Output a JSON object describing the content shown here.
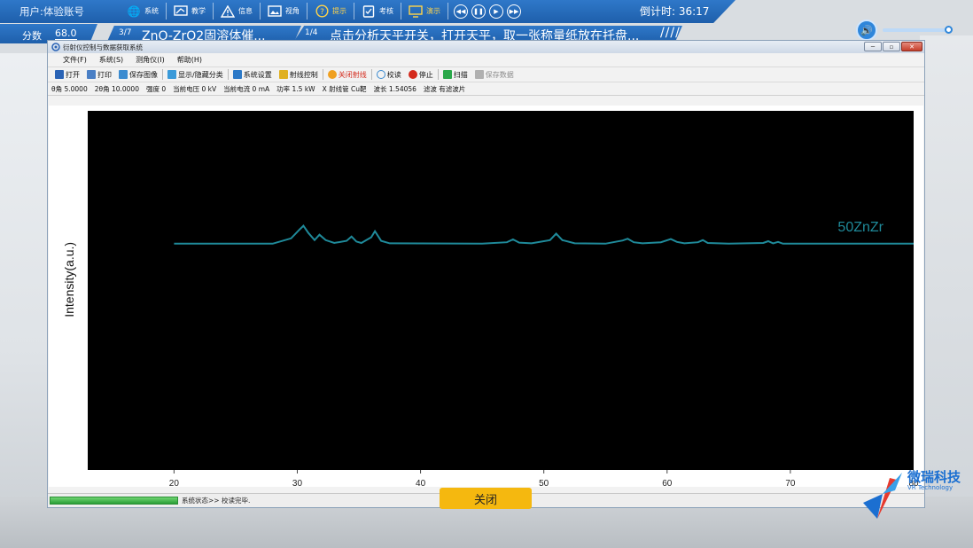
{
  "header": {
    "user": "用户:体验账号",
    "menu": [
      {
        "label": "系统",
        "icon": "globe-icon"
      },
      {
        "label": "教学",
        "icon": "teach-icon"
      },
      {
        "label": "信息",
        "icon": "warning-icon"
      },
      {
        "label": "视角",
        "icon": "image-icon"
      },
      {
        "label": "提示",
        "icon": "question-icon"
      },
      {
        "label": "考核",
        "icon": "clipboard-icon"
      },
      {
        "label": "演示",
        "icon": "monitor-icon"
      }
    ],
    "countdown": "倒计时: 36:17",
    "score_label": "分数",
    "score_value": "68.0",
    "step_count": "3/7",
    "step_title": "ZnO-ZrO2固溶体催...",
    "task_count": "1/4",
    "task_text": "点击分析天平开关，打开天平，取一张称量纸放在托盘..."
  },
  "window": {
    "title": "衍射仪控制与数据获取系统",
    "menu": [
      "文件(F)",
      "系统(S)",
      "测角仪(I)",
      "帮助(H)"
    ],
    "toolbar": [
      {
        "label": "打开",
        "icon": "open-icon",
        "color": "#2a63b5"
      },
      {
        "label": "打印",
        "icon": "print-icon",
        "color": "#4a7fc5"
      },
      {
        "label": "保存图像",
        "icon": "save-image-icon",
        "color": "#3b8bd0"
      },
      {
        "label": "显示/隐藏分类",
        "icon": "show-hide-icon",
        "color": "#3a9ad9"
      },
      {
        "label": "系统设置",
        "icon": "settings-icon",
        "color": "#2c79c7"
      },
      {
        "label": "射线控制",
        "icon": "radiation-icon",
        "color": "#e0b020"
      },
      {
        "label": "关闭射线",
        "icon": "close-ray-icon",
        "color": "#f0a020"
      },
      {
        "label": "校读",
        "icon": "calibrate-icon",
        "color": "#3a8ad0"
      },
      {
        "label": "停止",
        "icon": "stop-icon",
        "color": "#d42a1c"
      },
      {
        "label": "扫描",
        "icon": "scan-icon",
        "color": "#2aa84a"
      },
      {
        "label": "保存数据",
        "icon": "save-data-icon",
        "color": "#9a9a9a"
      }
    ],
    "status": {
      "theta": "θ角  5.0000",
      "two_theta": "2θ角  10.0000",
      "intensity": "强度  0",
      "voltage": "当前电压  0 kV",
      "current": "当前电流  0 mA",
      "power": "功率  1.5 kW",
      "tube": "X 射线管  Cu靶",
      "wavelength": "波长  1.54056",
      "filter": "滤波  有滤波片"
    },
    "bottom_status": "系统状态>> 校读完毕.",
    "progress": 1.0
  },
  "close_button": "关闭",
  "logo": {
    "text": "微瑞科技",
    "sub": "VR Technology"
  },
  "chart_data": {
    "type": "line",
    "title": "",
    "xlabel": "",
    "ylabel": "Intensity(a.u.)",
    "xlim": [
      13,
      80
    ],
    "ylim": [
      0,
      100
    ],
    "xticks": [
      20,
      30,
      40,
      50,
      60,
      70,
      80
    ],
    "grid": false,
    "legend_position": "top-right",
    "series": [
      {
        "name": "50ZnZr",
        "color": "#1f8a9a",
        "x": [
          20,
          28,
          29.5,
          30.2,
          30.5,
          30.9,
          31.4,
          31.8,
          32.3,
          33,
          34,
          34.4,
          34.8,
          35.2,
          35.6,
          36.0,
          36.3,
          36.8,
          37.5,
          45,
          47.0,
          47.5,
          48.0,
          49,
          50.5,
          51.0,
          51.5,
          52.5,
          55,
          56.4,
          56.8,
          57.3,
          58,
          59.5,
          60.3,
          60.8,
          61.4,
          62.5,
          62.9,
          63.3,
          65,
          67.8,
          68.2,
          68.6,
          69.0,
          69.4,
          80
        ],
        "y": [
          63,
          63,
          64.5,
          67,
          68,
          66,
          64,
          65.5,
          64,
          63.2,
          63.8,
          65,
          63.6,
          63.2,
          64,
          64.8,
          66.5,
          63.8,
          63.1,
          63.0,
          63.4,
          64.2,
          63.3,
          63.1,
          64.0,
          65.8,
          64.0,
          63.1,
          63.0,
          63.9,
          64.4,
          63.4,
          63.1,
          63.4,
          64.3,
          63.5,
          63.1,
          63.4,
          64.0,
          63.2,
          63.0,
          63.2,
          63.7,
          63.1,
          63.5,
          63.0,
          63.0
        ]
      }
    ]
  }
}
